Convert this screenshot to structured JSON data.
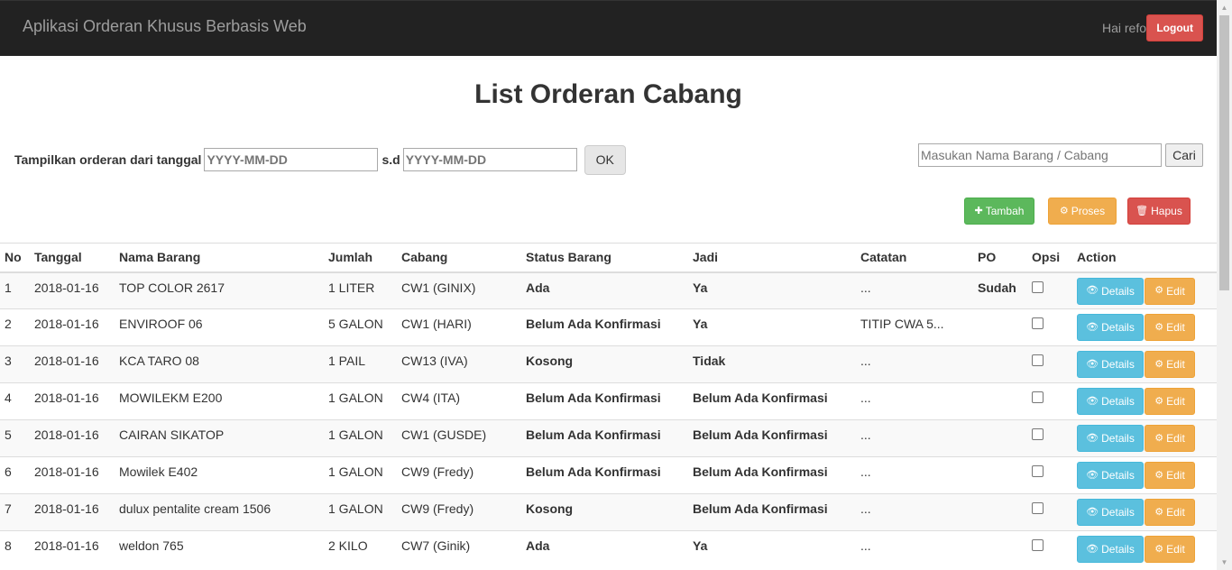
{
  "navbar": {
    "brand": "Aplikasi Orderan Khusus Berbasis Web",
    "greeting": "Hai refo",
    "logout_label": "Logout"
  },
  "page": {
    "title": "List Orderan Cabang"
  },
  "filter": {
    "label": "Tampilkan orderan dari tanggal",
    "from_placeholder": "YYYY-MM-DD",
    "separator": "s.d",
    "to_placeholder": "YYYY-MM-DD",
    "ok_label": "OK"
  },
  "search": {
    "placeholder": "Masukan Nama Barang / Cabang",
    "button_label": "Cari"
  },
  "actions": {
    "tambah": "Tambah",
    "proses": "Proses",
    "hapus": "Hapus"
  },
  "colors": {
    "status_green": "#1a8f1a",
    "status_red": "#e00000",
    "btn_success": "#5cb85c",
    "btn_warning": "#f0ad4e",
    "btn_danger": "#d9534f",
    "btn_info": "#5bc0de"
  },
  "table": {
    "columns": [
      "No",
      "Tanggal",
      "Nama Barang",
      "Jumlah",
      "Cabang",
      "Status Barang",
      "Jadi",
      "Catatan",
      "PO",
      "Opsi",
      "Action"
    ],
    "details_label": "Details",
    "edit_label": "Edit",
    "rows": [
      {
        "no": "1",
        "tanggal": "2018-01-16",
        "nama": "TOP COLOR 2617",
        "jumlah": "1 LITER",
        "cabang": "CW1 (GINIX)",
        "status": "Ada",
        "status_color": "green",
        "jadi": "Ya",
        "jadi_color": "green",
        "catatan": "...",
        "po": "Sudah"
      },
      {
        "no": "2",
        "tanggal": "2018-01-16",
        "nama": "ENVIROOF 06",
        "jumlah": "5 GALON",
        "cabang": "CW1 (HARI)",
        "status": "Belum Ada Konfirmasi",
        "status_color": "black",
        "jadi": "Ya",
        "jadi_color": "green",
        "catatan": "TITIP CWA 5...",
        "po": ""
      },
      {
        "no": "3",
        "tanggal": "2018-01-16",
        "nama": "KCA TARO 08",
        "jumlah": "1 PAIL",
        "cabang": "CW13 (IVA)",
        "status": "Kosong",
        "status_color": "red",
        "jadi": "Tidak",
        "jadi_color": "red",
        "catatan": "...",
        "po": ""
      },
      {
        "no": "4",
        "tanggal": "2018-01-16",
        "nama": "MOWILEKM E200",
        "jumlah": "1 GALON",
        "cabang": "CW4 (ITA)",
        "status": "Belum Ada Konfirmasi",
        "status_color": "black",
        "jadi": "Belum Ada Konfirmasi",
        "jadi_color": "black",
        "catatan": "...",
        "po": ""
      },
      {
        "no": "5",
        "tanggal": "2018-01-16",
        "nama": "CAIRAN SIKATOP",
        "jumlah": "1 GALON",
        "cabang": "CW1 (GUSDE)",
        "status": "Belum Ada Konfirmasi",
        "status_color": "black",
        "jadi": "Belum Ada Konfirmasi",
        "jadi_color": "black",
        "catatan": "...",
        "po": ""
      },
      {
        "no": "6",
        "tanggal": "2018-01-16",
        "nama": "Mowilek E402",
        "jumlah": "1 GALON",
        "cabang": "CW9 (Fredy)",
        "status": "Belum Ada Konfirmasi",
        "status_color": "black",
        "jadi": "Belum Ada Konfirmasi",
        "jadi_color": "black",
        "catatan": "...",
        "po": ""
      },
      {
        "no": "7",
        "tanggal": "2018-01-16",
        "nama": "dulux pentalite cream 1506",
        "jumlah": "1 GALON",
        "cabang": "CW9 (Fredy)",
        "status": "Kosong",
        "status_color": "red",
        "jadi": "Belum Ada Konfirmasi",
        "jadi_color": "black",
        "catatan": "...",
        "po": ""
      },
      {
        "no": "8",
        "tanggal": "2018-01-16",
        "nama": "weldon 765",
        "jumlah": "2 KILO",
        "cabang": "CW7 (Ginik)",
        "status": "Ada",
        "status_color": "green",
        "jadi": "Ya",
        "jadi_color": "green",
        "catatan": "...",
        "po": ""
      }
    ]
  }
}
